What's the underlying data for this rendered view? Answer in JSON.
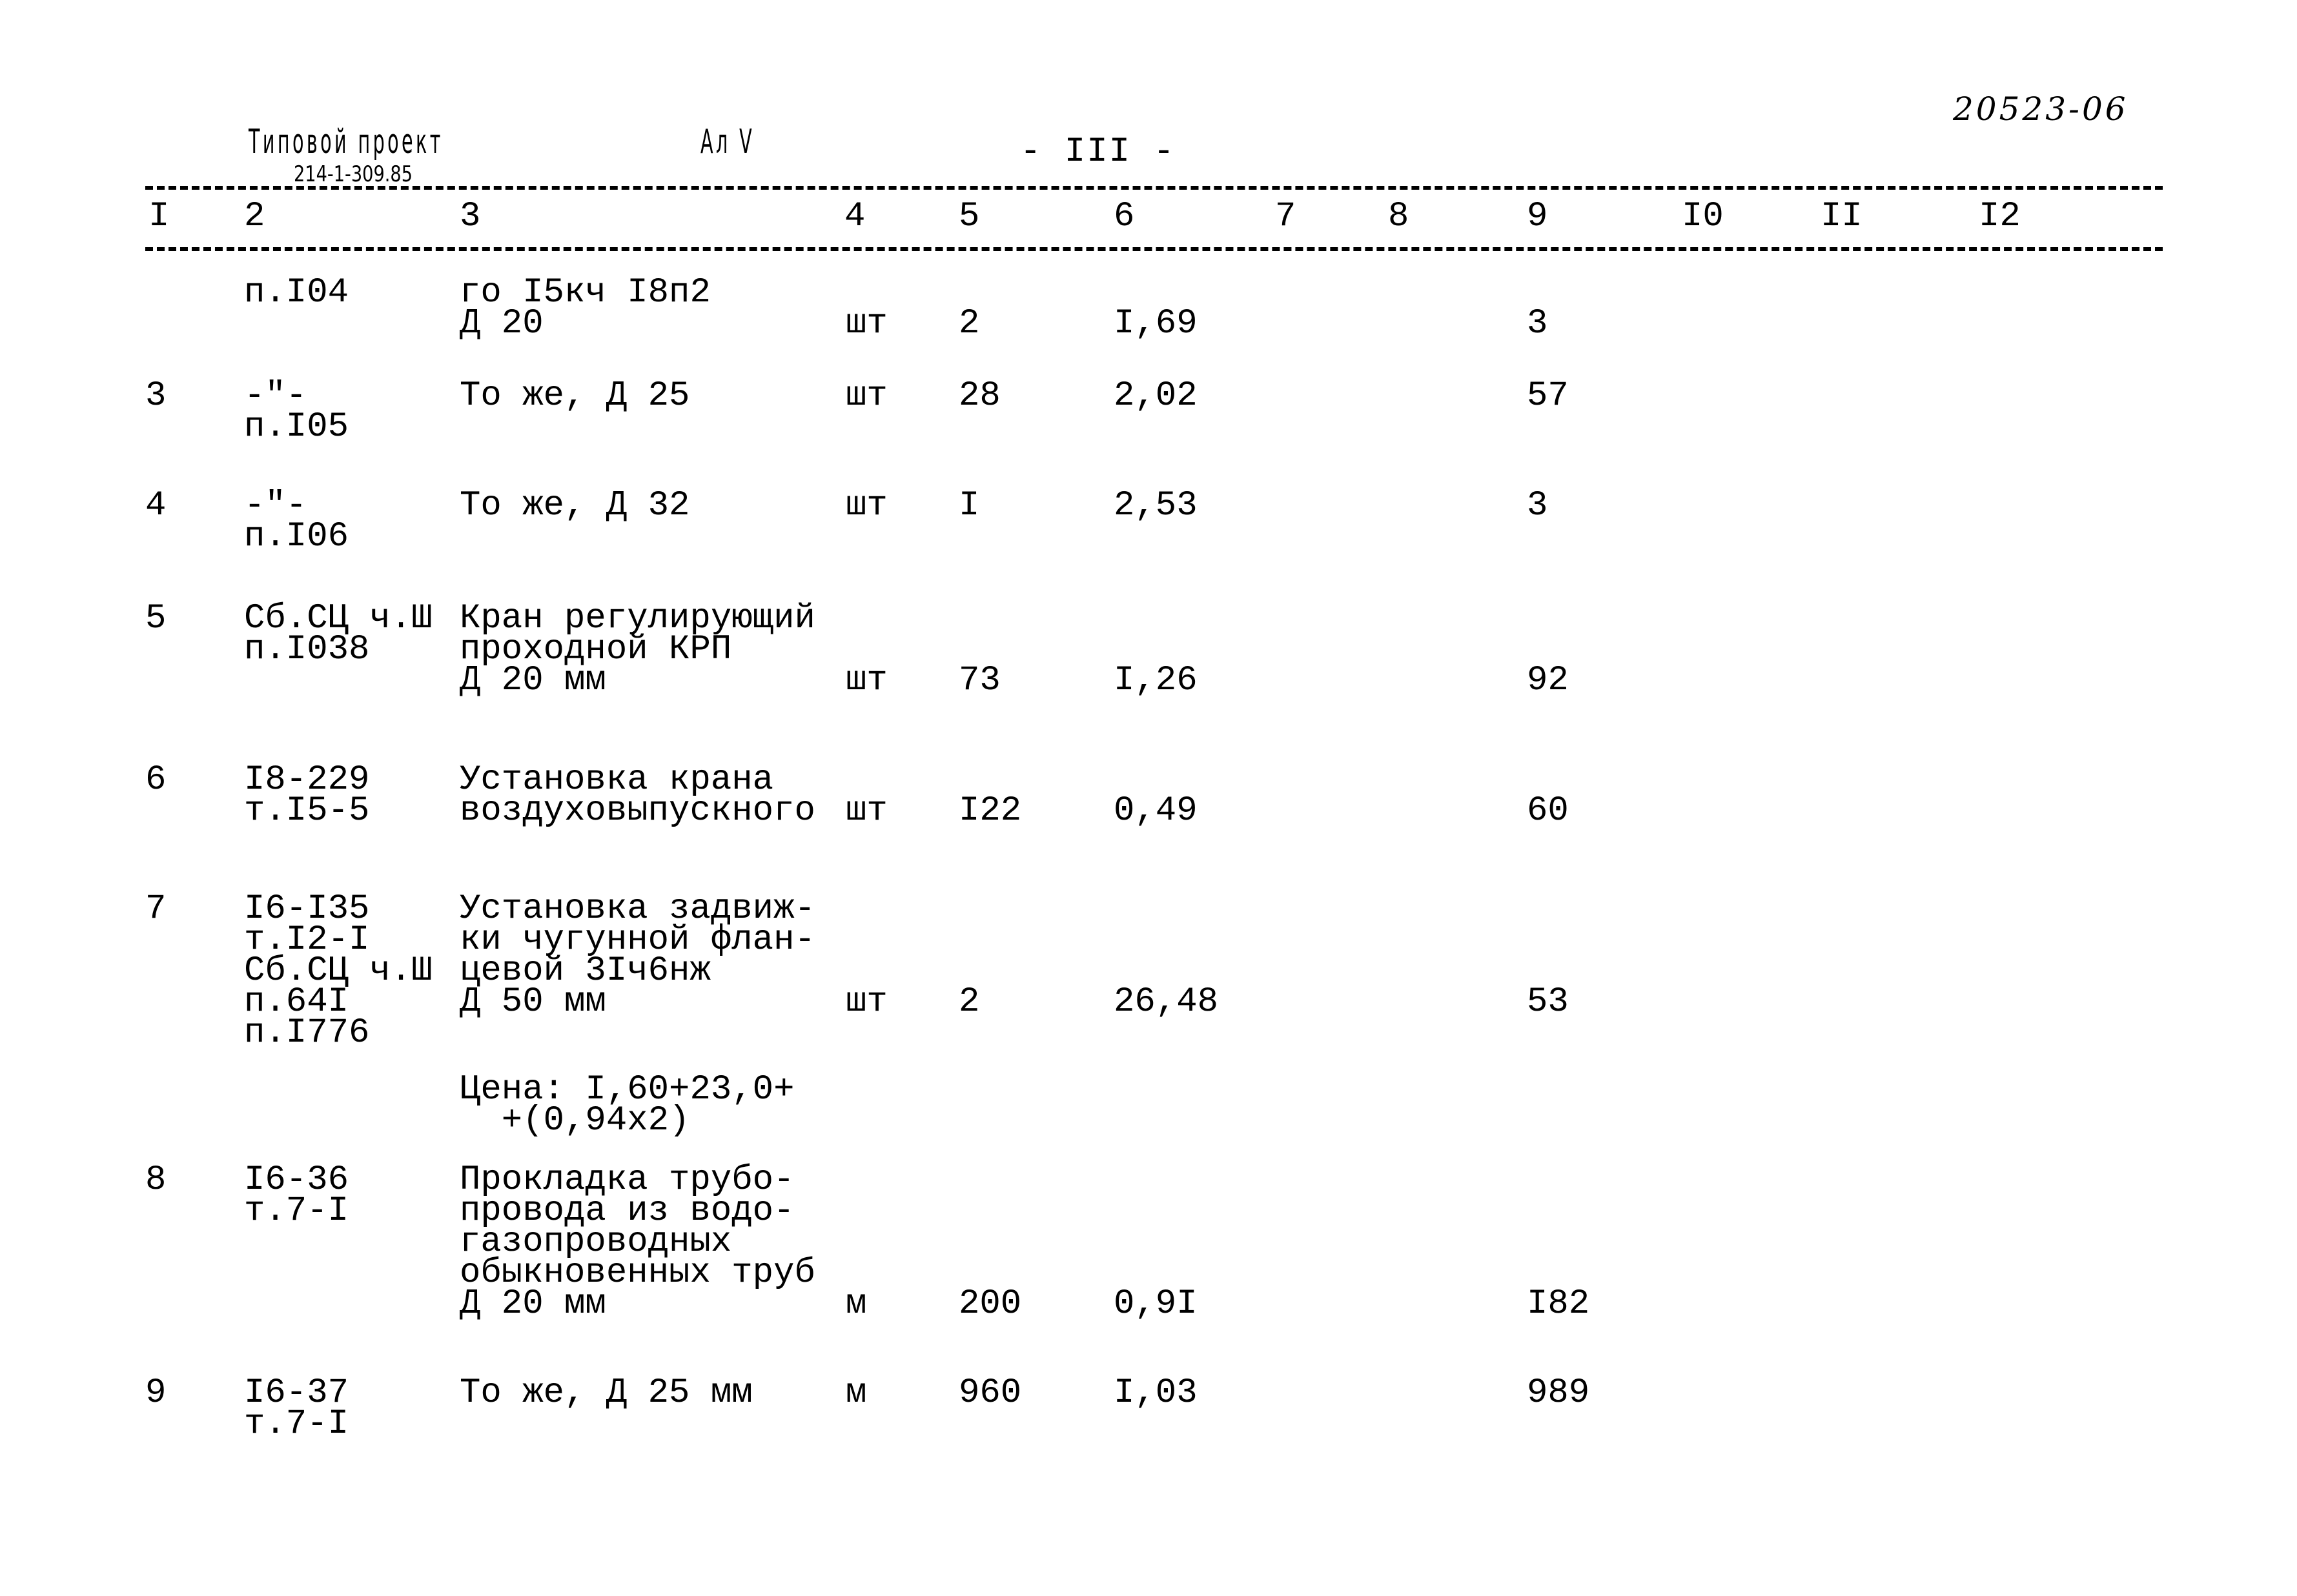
{
  "header": {
    "stamp_title": "Типовой проект",
    "stamp_album": "Ал V",
    "stamp_code": "214-1-309.85",
    "page_number": "- III -",
    "document_id": "20523-06"
  },
  "columns": [
    "I",
    "2",
    "3",
    "4",
    "5",
    "6",
    "7",
    "8",
    "9",
    "I0",
    "II",
    "I2"
  ],
  "rows": [
    {
      "num": "",
      "ref": [
        "п.I04"
      ],
      "desc": [
        "го I5кч I8п2",
        "Д 20"
      ],
      "unit": "шт",
      "qty": "2",
      "price": "I,69",
      "total": "3"
    },
    {
      "num": "3",
      "ref": [
        "-\"-",
        "п.I05"
      ],
      "desc": [
        "То же, Д 25"
      ],
      "unit": "шт",
      "qty": "28",
      "price": "2,02",
      "total": "57"
    },
    {
      "num": "4",
      "ref": [
        "-\"-",
        "п.I06"
      ],
      "desc": [
        "То же, Д 32"
      ],
      "unit": "шт",
      "qty": "I",
      "price": "2,53",
      "total": "3"
    },
    {
      "num": "5",
      "ref": [
        "Сб.СЦ ч.Ш",
        "п.I038"
      ],
      "desc": [
        "Кран регулирующий",
        "проходной КРП",
        "Д 20 мм"
      ],
      "unit": "шт",
      "qty": "73",
      "price": "I,26",
      "total": "92"
    },
    {
      "num": "6",
      "ref": [
        "I8-229",
        "т.I5-5"
      ],
      "desc": [
        "Установка крана",
        "воздуховыпускного"
      ],
      "unit": "шт",
      "qty": "I22",
      "price": "0,49",
      "total": "60"
    },
    {
      "num": "7",
      "ref": [
        "I6-I35",
        "т.I2-I",
        "Сб.СЦ ч.Ш",
        "п.64I",
        "п.I776"
      ],
      "desc": [
        "Установка задвиж-",
        "ки чугунной флан-",
        "цевой 3Iч6нж",
        "Д 50 мм"
      ],
      "note": [
        "Цена: I,60+23,0+",
        "  +(0,94х2)"
      ],
      "unit": "шт",
      "qty": "2",
      "price": "26,48",
      "total": "53"
    },
    {
      "num": "8",
      "ref": [
        "I6-36",
        "т.7-I"
      ],
      "desc": [
        "Прокладка трубо-",
        "провода из водо-",
        "газопроводных",
        "обыкновенных труб",
        "Д 20 мм"
      ],
      "unit": "м",
      "qty": "200",
      "price": "0,9I",
      "total": "I82"
    },
    {
      "num": "9",
      "ref": [
        "I6-37",
        "т.7-I"
      ],
      "desc": [
        "То же, Д 25 мм"
      ],
      "unit": "м",
      "qty": "960",
      "price": "I,03",
      "total": "989"
    }
  ]
}
